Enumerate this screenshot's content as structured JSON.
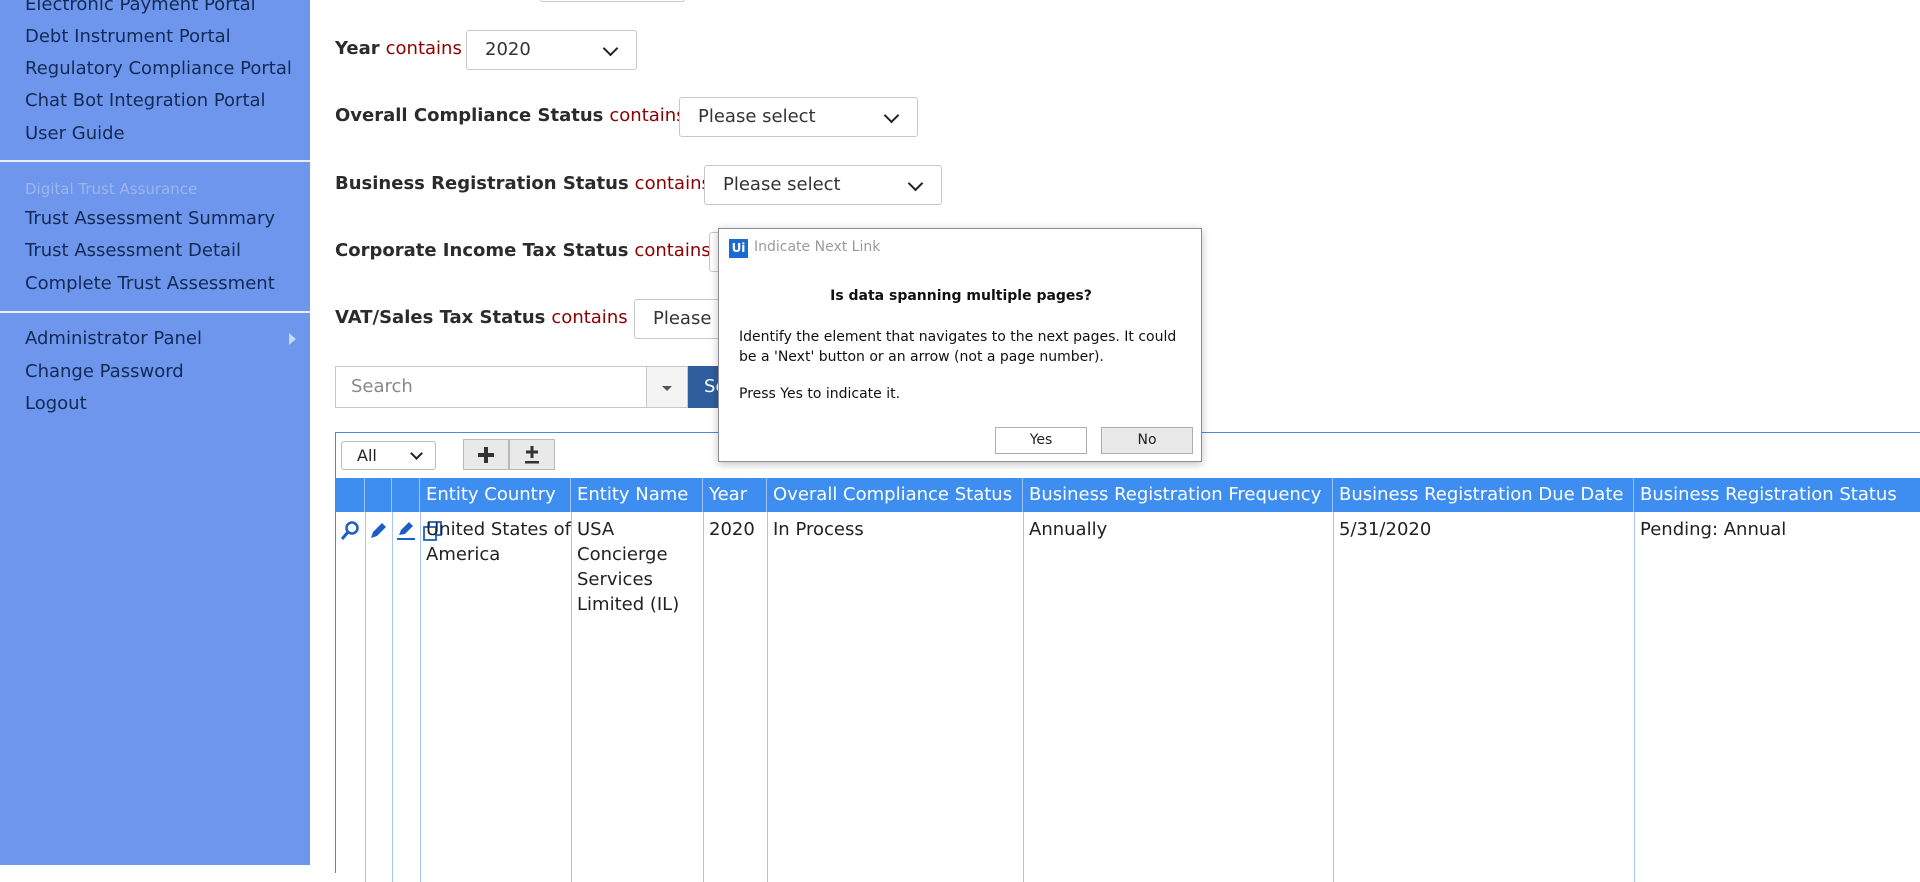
{
  "sidebar": {
    "items_top": [
      "Electronic Payment Portal",
      "Debt Instrument Portal",
      "Regulatory Compliance Portal",
      "Chat Bot Integration Portal",
      "User Guide"
    ],
    "section_title": "Digital Trust Assurance",
    "items_section": [
      "Trust Assessment Summary",
      "Trust Assessment Detail",
      "Complete Trust Assessment"
    ],
    "items_bottom": [
      "Administrator Panel",
      "Change Password",
      "Logout"
    ]
  },
  "filters": {
    "operator": "contains",
    "year": {
      "label": "Year",
      "value": "2020"
    },
    "overall": {
      "label": "Overall Compliance Status",
      "value": "Please select"
    },
    "bizreg": {
      "label": "Business Registration Status",
      "value": "Please select"
    },
    "corptax": {
      "label": "Corporate Income Tax Status",
      "value": ""
    },
    "vat": {
      "label": "VAT/Sales Tax Status",
      "value": "Please s"
    }
  },
  "search": {
    "placeholder": "Search",
    "button_label": "Se"
  },
  "grid": {
    "page_size": "All",
    "columns": [
      "Entity Country",
      "Entity Name",
      "Year",
      "Overall Compliance Status",
      "Business Registration Frequency",
      "Business Registration Due Date",
      "Business Registration Status"
    ],
    "rows": [
      {
        "entity_country": "United States of America",
        "entity_name": "USA Concierge Services Limited (IL)",
        "year": "2020",
        "overall_status": "In Process",
        "reg_frequency": "Annually",
        "reg_due_date": "5/31/2020",
        "reg_status": "Pending: Annual"
      }
    ]
  },
  "dialog": {
    "title": "Indicate Next Link",
    "logo_text": "Ui",
    "heading": "Is data spanning multiple pages?",
    "body": "Identify the element that navigates to the next pages. It could be a 'Next' button or an arrow (not a page number).",
    "prompt": "Press Yes to indicate it.",
    "yes_label": "Yes",
    "no_label": "No"
  },
  "colors": {
    "sidebar_bg": "#6d96ec",
    "grid_header": "#3d8ef0",
    "operator_text": "#8b0000",
    "search_button": "#2f5e9e"
  }
}
